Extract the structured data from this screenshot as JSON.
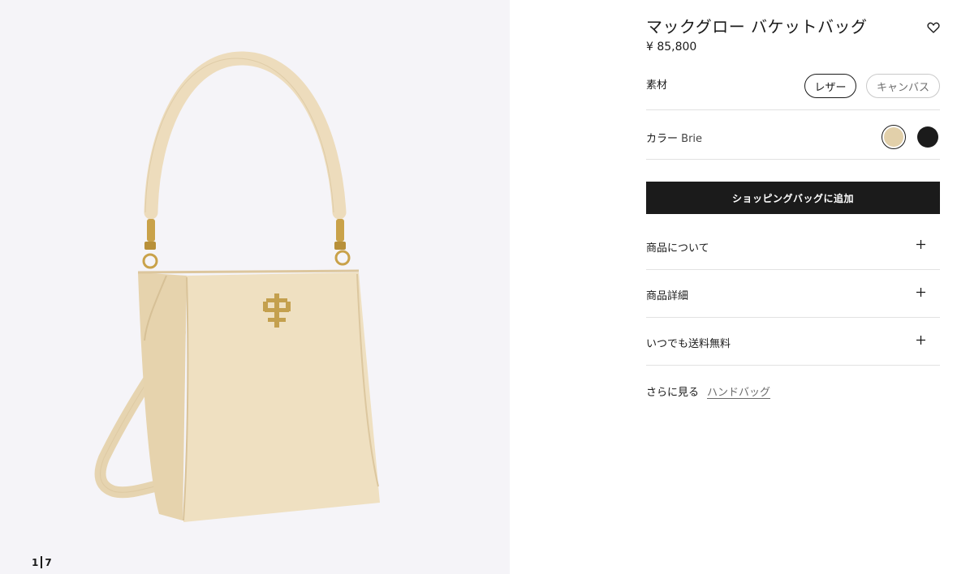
{
  "gallery": {
    "current_page": "1",
    "total_pages": "7"
  },
  "product": {
    "title": "マックグロー バケットバッグ",
    "price": "¥ 85,800"
  },
  "material": {
    "label": "素材",
    "options": [
      {
        "label": "レザー",
        "selected": true
      },
      {
        "label": "キャンバス",
        "selected": false
      }
    ]
  },
  "color": {
    "label": "カラー",
    "selected_name": "Brie",
    "swatches": [
      {
        "name": "brie",
        "hex": "#e2d0aa",
        "selected": true
      },
      {
        "name": "black",
        "hex": "#1b1b1b",
        "selected": false
      }
    ]
  },
  "cart": {
    "add_label": "ショッピングバッグに追加"
  },
  "accordion": [
    {
      "label": "商品について",
      "icon": "plus-icon"
    },
    {
      "label": "商品詳細",
      "icon": "plus-icon"
    },
    {
      "label": "いつでも送料無料",
      "icon": "plus-icon"
    }
  ],
  "more": {
    "label": "さらに見る",
    "link": "ハンドバッグ"
  },
  "colors": {
    "gallery_bg": "#f5f4f8",
    "bag_leather": "#eedebd",
    "bag_hardware": "#c9a24a",
    "button_bg": "#1b1b1b"
  },
  "icons": {
    "wishlist": "heart-icon"
  }
}
